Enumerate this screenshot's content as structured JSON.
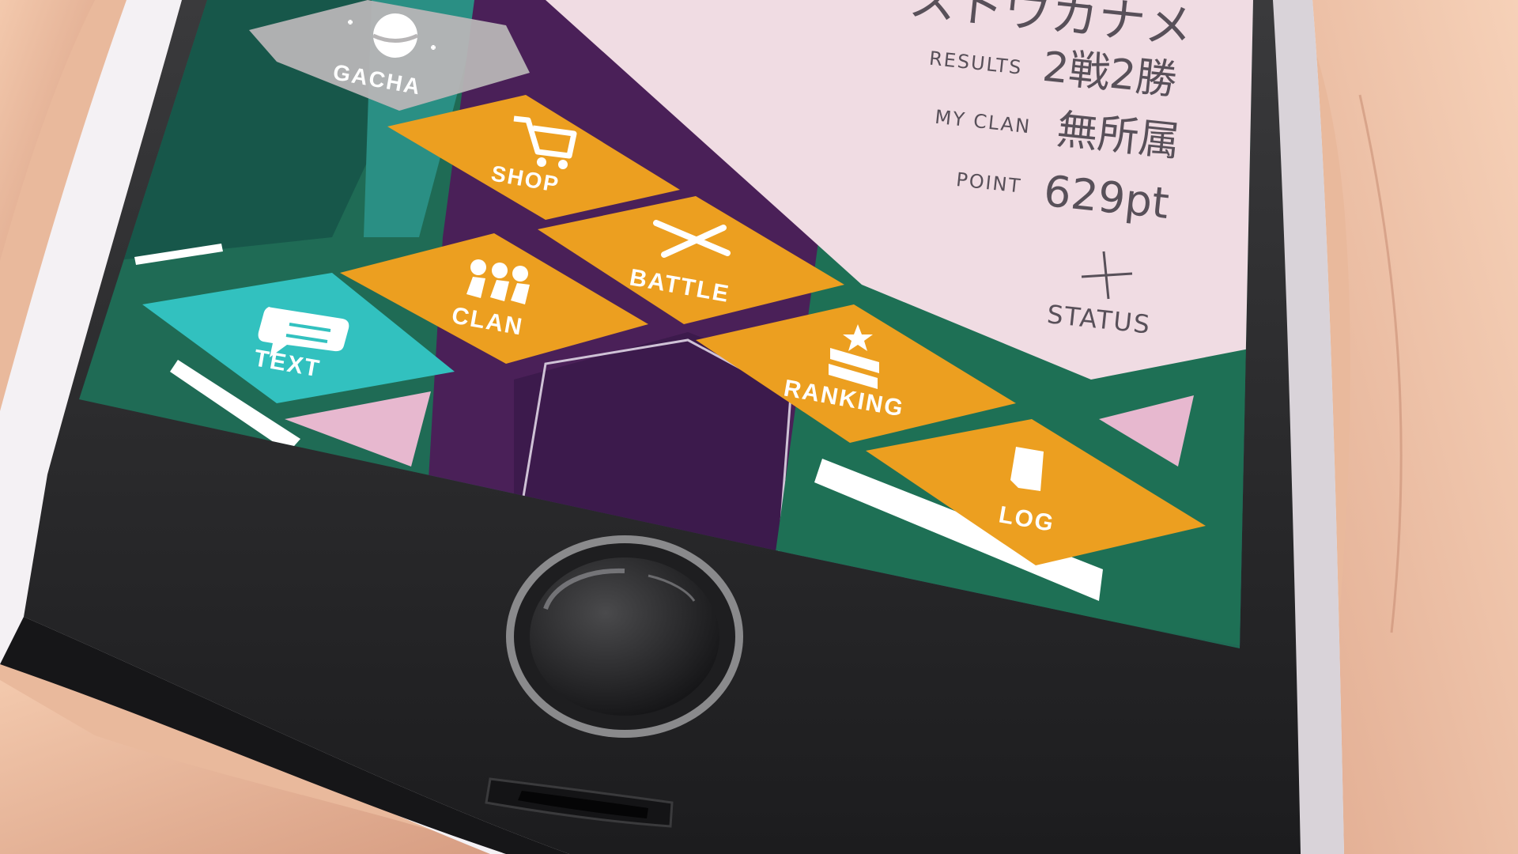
{
  "profile": {
    "name": "ストウカナメ",
    "results_label": "RESULTS",
    "results_value": "2戦2勝",
    "clan_label": "MY CLAN",
    "clan_value": "無所属",
    "point_label": "POINT",
    "point_value": "629pt",
    "status_label": "STATUS"
  },
  "menu": {
    "gacha": "GACHA",
    "shop": "SHOP",
    "battle": "BATTLE",
    "clan": "CLAN",
    "text": "TEXT",
    "ranking": "RANKING",
    "log": "LOG"
  },
  "colors": {
    "orange_tile": "#ec9f20",
    "teal_tile": "#32c1bf",
    "gray_tile": "#b7b5b6",
    "purple_bg": "#4c2159",
    "green_bg": "#1c6b54",
    "pink_panel": "#f0dce3"
  },
  "icons": {
    "gacha": "gacha-capsule-icon",
    "shop": "cart-icon",
    "battle": "crossed-swords-icon",
    "clan": "people-icon",
    "text": "speech-bubble-icon",
    "ranking": "rank-chevron-star-icon",
    "log": "document-icon",
    "status": "plus-icon"
  }
}
